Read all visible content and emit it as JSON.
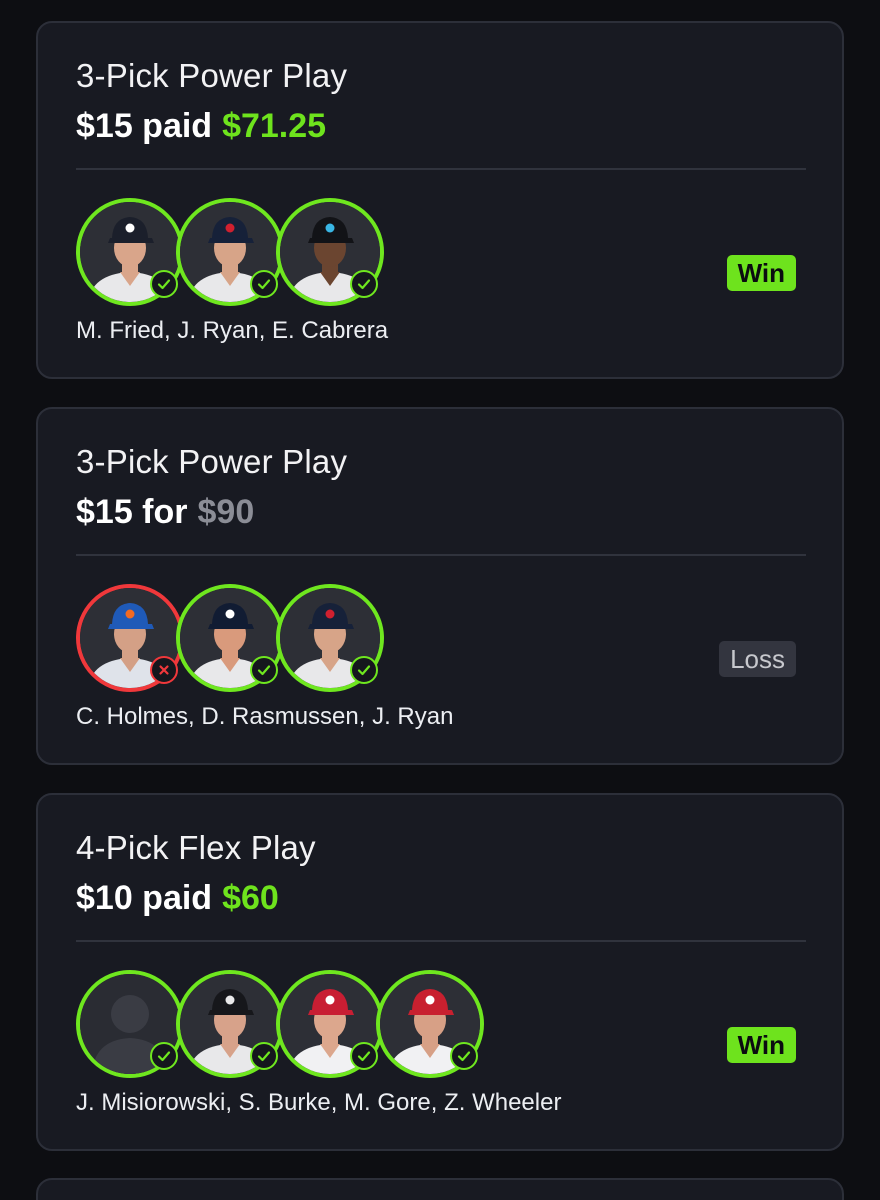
{
  "cards": [
    {
      "title": "3-Pick Power Play",
      "amount_main": "$15 paid",
      "amount_secondary": "$71.25",
      "amount_secondary_color": "#6ee31d",
      "result": "Win",
      "names": "M. Fried, J. Ryan, E. Cabrera",
      "players": [
        {
          "team_icon": "yankees-cap-icon",
          "status": "hit",
          "cap_color": "#1b1f2b",
          "logo_color": "#ffffff",
          "skin": "#d9a58a",
          "jersey": "#e8e8ea"
        },
        {
          "team_icon": "twins-cap-icon",
          "status": "hit",
          "cap_color": "#162139",
          "logo_color": "#d0202f",
          "skin": "#d7a488",
          "jersey": "#e8e8ea"
        },
        {
          "team_icon": "marlins-cap-icon",
          "status": "hit",
          "cap_color": "#121317",
          "logo_color": "#39b6e5",
          "skin": "#6b4530",
          "jersey": "#e8e8ea"
        }
      ]
    },
    {
      "title": "3-Pick Power Play",
      "amount_main": "$15 for",
      "amount_secondary": "$90",
      "amount_secondary_color": "#8b8d96",
      "result": "Loss",
      "names": "C. Holmes, D. Rasmussen, J. Ryan",
      "players": [
        {
          "team_icon": "mets-cap-icon",
          "status": "miss",
          "cap_color": "#1f5ab8",
          "logo_color": "#f26a22",
          "skin": "#d4a086",
          "jersey": "#dfe3ea"
        },
        {
          "team_icon": "rays-cap-icon",
          "status": "hit",
          "cap_color": "#111c33",
          "logo_color": "#ffffff",
          "skin": "#d99a7c",
          "jersey": "#e8e8ea"
        },
        {
          "team_icon": "twins-cap-icon",
          "status": "hit",
          "cap_color": "#162139",
          "logo_color": "#d0202f",
          "skin": "#d7a488",
          "jersey": "#e8e8ea"
        }
      ]
    },
    {
      "title": "4-Pick Flex Play",
      "amount_main": "$10 paid",
      "amount_secondary": "$60",
      "amount_secondary_color": "#6ee31d",
      "result": "Win",
      "names": "J. Misiorowski, S. Burke, M. Gore, Z. Wheeler",
      "players": [
        {
          "team_icon": "placeholder-silhouette-icon",
          "status": "hit",
          "placeholder": true
        },
        {
          "team_icon": "white-sox-cap-icon",
          "status": "hit",
          "cap_color": "#16171b",
          "logo_color": "#e9e9ea",
          "skin": "#d7a28a",
          "jersey": "#e8e8ea"
        },
        {
          "team_icon": "nationals-cap-icon",
          "status": "hit",
          "cap_color": "#c81e33",
          "logo_color": "#ffffff",
          "skin": "#dca78d",
          "jersey": "#f1f1f3"
        },
        {
          "team_icon": "phillies-cap-icon",
          "status": "hit",
          "cap_color": "#c8202f",
          "logo_color": "#ffffff",
          "skin": "#d7a086",
          "jersey": "#f1f1f3"
        }
      ]
    }
  ]
}
